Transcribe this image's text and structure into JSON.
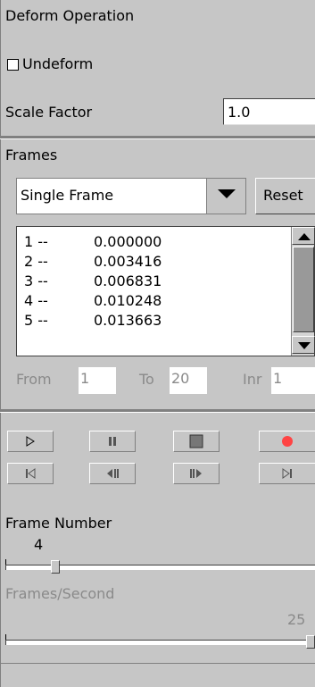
{
  "deform": {
    "title": "Deform Operation",
    "undeform_label": "Undeform",
    "undeform_checked": false,
    "scale_label": "Scale Factor",
    "scale_value": "1.0"
  },
  "frames": {
    "title": "Frames",
    "mode_selected": "Single Frame",
    "reset_label": "Reset",
    "list": [
      {
        "index": "1 --",
        "value": "0.000000"
      },
      {
        "index": "2 --",
        "value": "0.003416"
      },
      {
        "index": "3 --",
        "value": "0.006831"
      },
      {
        "index": "4 --",
        "value": "0.010248"
      },
      {
        "index": "5 --",
        "value": "0.013663"
      }
    ],
    "from_label": "From",
    "from_value": "1",
    "to_label": "To",
    "to_value": "20",
    "inr_label": "Inr",
    "inr_value": "1"
  },
  "playback": {
    "record_color": "#ff4444",
    "icons_row1": [
      "play-icon",
      "pause-icon",
      "stop-icon",
      "record-icon"
    ],
    "icons_row2": [
      "skip-to-start-icon",
      "step-back-icon",
      "step-forward-icon",
      "skip-to-end-icon"
    ]
  },
  "frame_number": {
    "label": "Frame Number",
    "value": "4",
    "slider_fraction": 0.15
  },
  "fps": {
    "label": "Frames/Second",
    "value": "25",
    "slider_fraction": 1.0
  }
}
